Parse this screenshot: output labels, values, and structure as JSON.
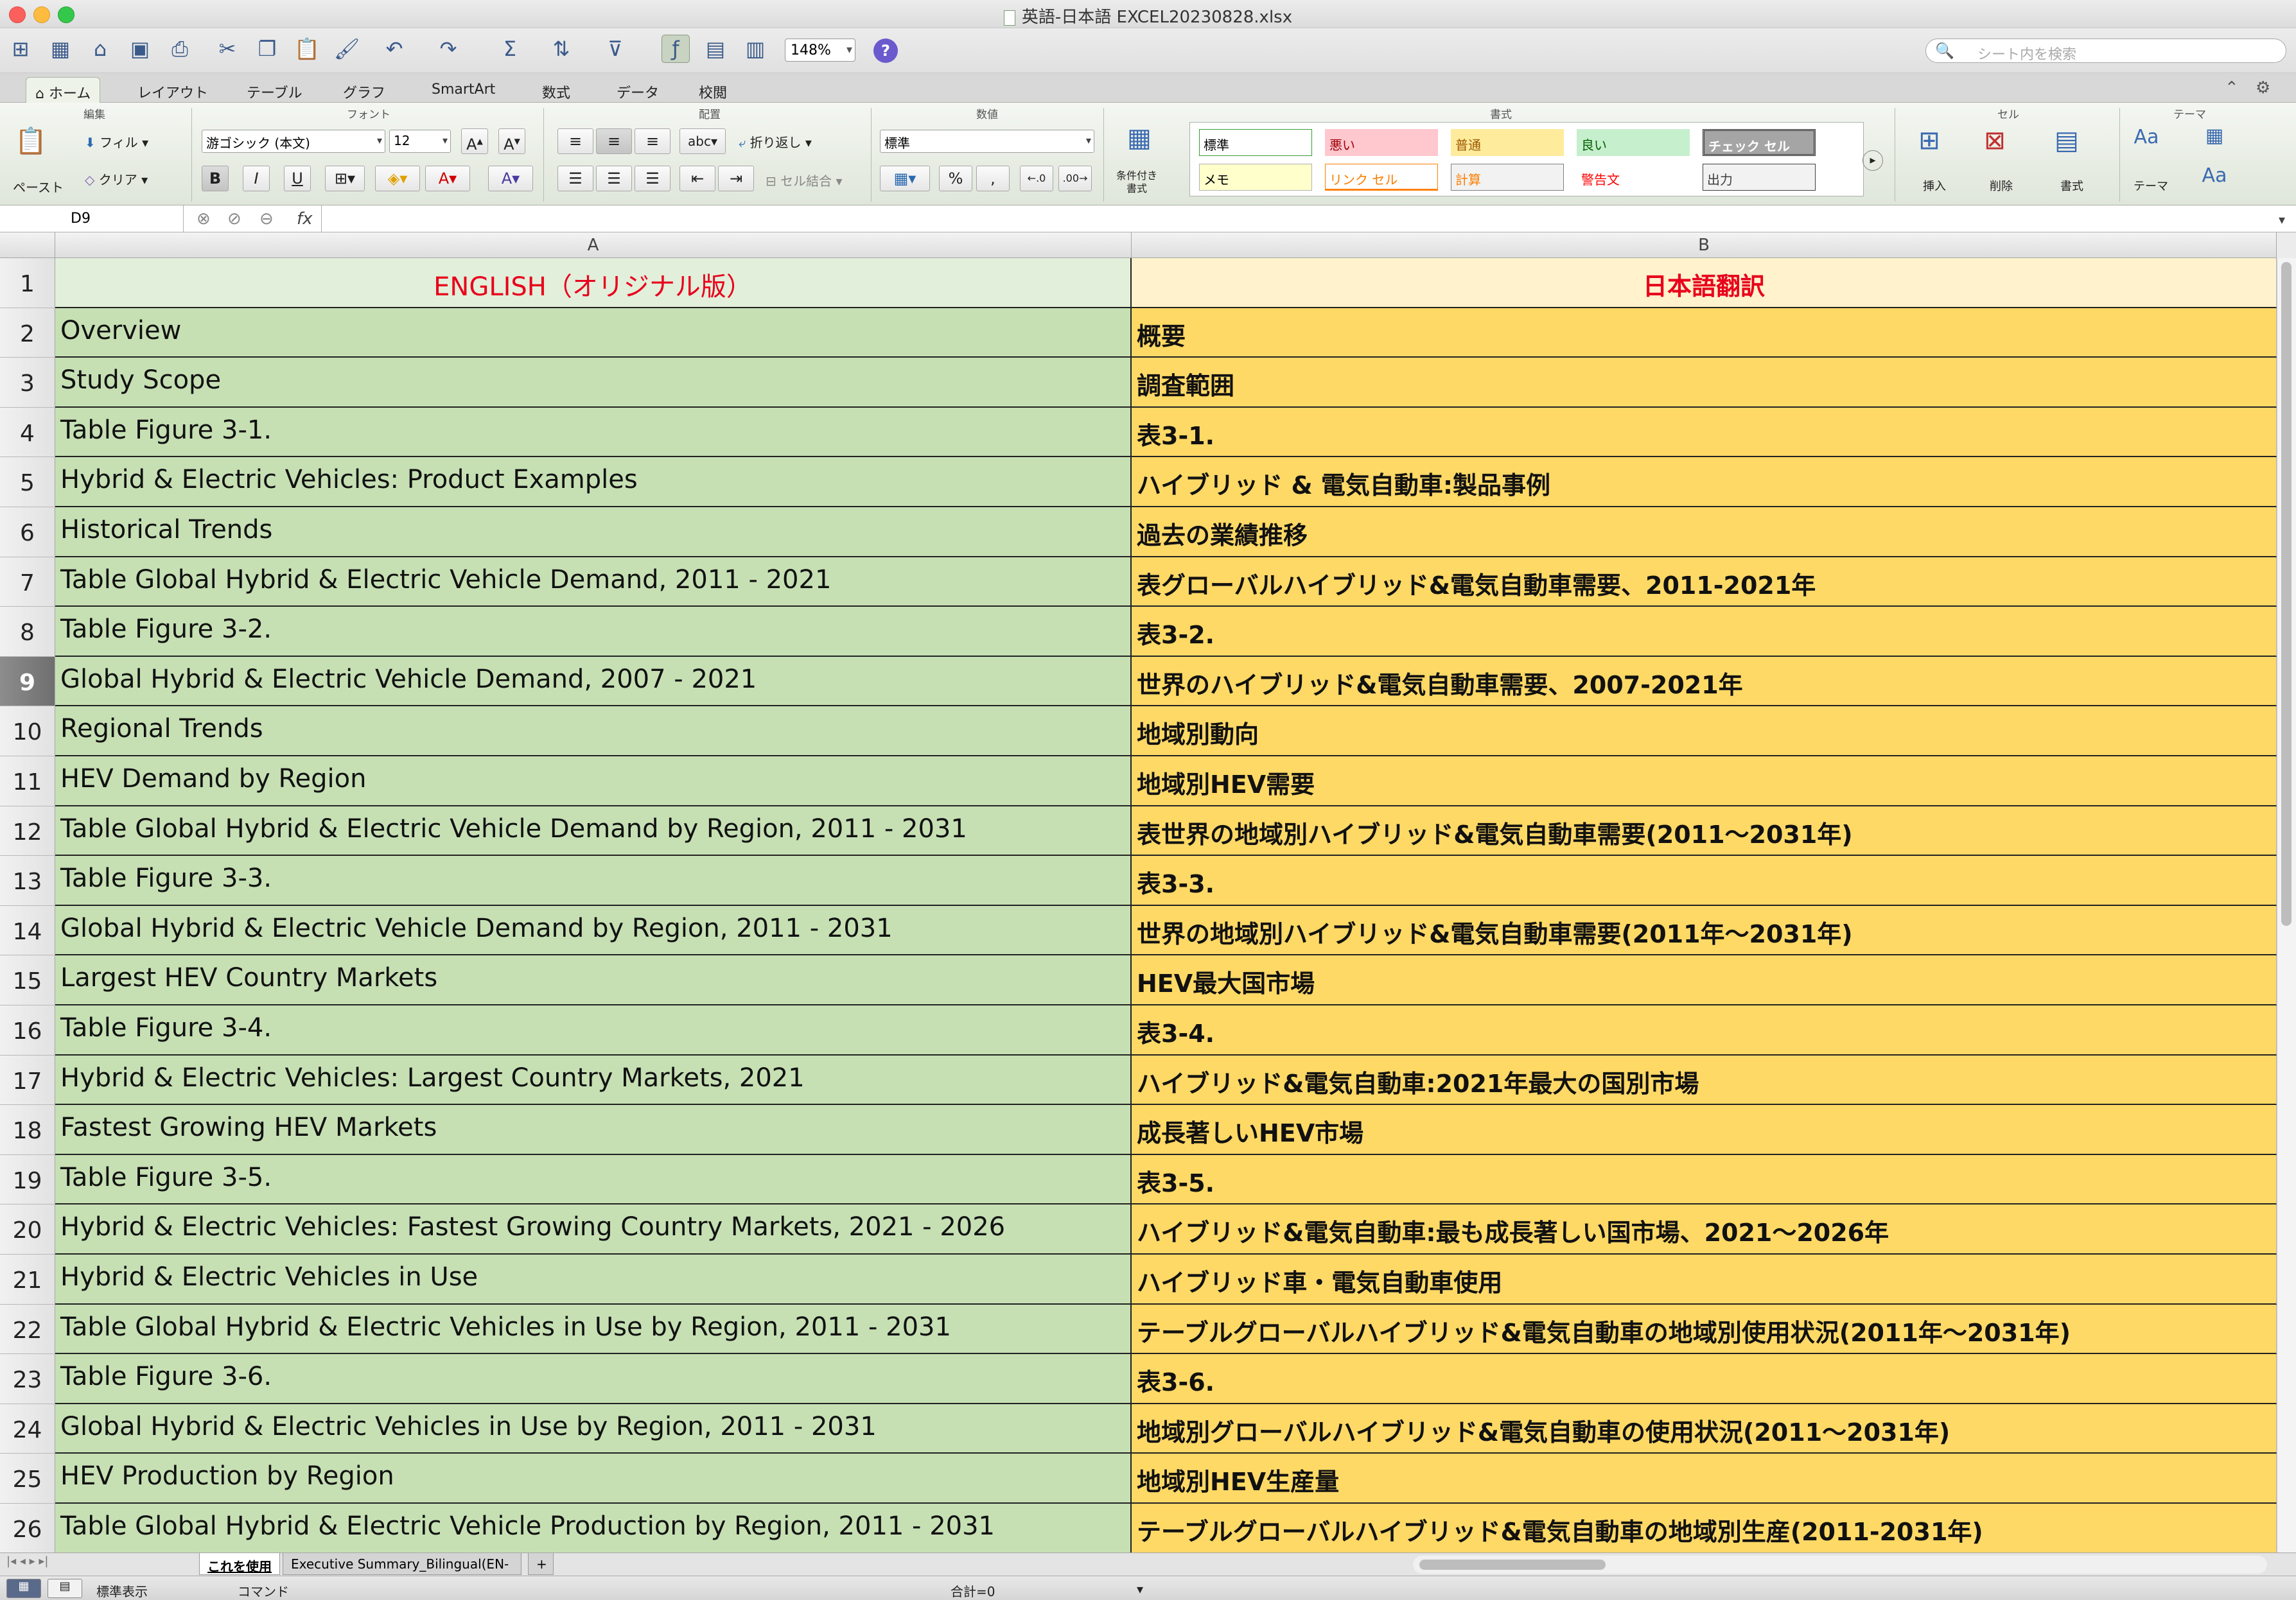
{
  "window": {
    "title": "英語-日本語 EXCEL20230828.xlsx"
  },
  "toolbar": {
    "zoom": "148%",
    "search_placeholder": "シート内を検索"
  },
  "tabs": [
    "ホーム",
    "レイアウト",
    "テーブル",
    "グラフ",
    "SmartArt",
    "数式",
    "データ",
    "校閲"
  ],
  "ribbon": {
    "groups": {
      "edit": "編集",
      "font": "フォント",
      "align": "配置",
      "number": "数値",
      "format": "書式",
      "cells": "セル",
      "theme": "テーマ"
    },
    "paste": "ペースト",
    "fill": "フィル",
    "clear": "クリア",
    "font_name": "游ゴシック (本文)",
    "font_size": "12",
    "bold": "B",
    "italic": "I",
    "underline": "U",
    "abc": "abc",
    "wrap": "折り返し",
    "merge": "セル結合",
    "number_format": "標準",
    "cond_format": "条件付き\n書式",
    "styles": [
      {
        "label": "標準",
        "bg": "#ffffff",
        "fg": "#000000",
        "border": "#3a9a3a"
      },
      {
        "label": "悪い",
        "bg": "#ffc7ce",
        "fg": "#9c0006",
        "border": "#ffc7ce"
      },
      {
        "label": "普通",
        "bg": "#ffeb9c",
        "fg": "#9c5700",
        "border": "#ffeb9c"
      },
      {
        "label": "良い",
        "bg": "#c6efce",
        "fg": "#006100",
        "border": "#c6efce"
      },
      {
        "label": "チェック セル",
        "bg": "#a5a5a5",
        "fg": "#ffffff",
        "border": "#3f3f3f"
      },
      {
        "label": "メモ",
        "bg": "#ffffcc",
        "fg": "#000000",
        "border": "#b2b2b2"
      },
      {
        "label": "リンク セル",
        "bg": "#ffffff",
        "fg": "#fa7d00",
        "border": "#ff8001"
      },
      {
        "label": "計算",
        "bg": "#f2f2f2",
        "fg": "#fa7d00",
        "border": "#7f7f7f"
      },
      {
        "label": "警告文",
        "bg": "#ffffff",
        "fg": "#ff0000",
        "border": "#ffffff"
      },
      {
        "label": "出力",
        "bg": "#f2f2f2",
        "fg": "#3f3f3f",
        "border": "#3f3f3f"
      }
    ],
    "insert": "挿入",
    "delete": "削除",
    "format": "書式",
    "theme": "テーマ"
  },
  "formula_bar": {
    "cell_ref": "D9",
    "fx": "fx",
    "content": ""
  },
  "columns": [
    "A",
    "B"
  ],
  "header_row": {
    "num": "1",
    "a": "ENGLISH（オリジナル版）",
    "b": "日本語翻訳"
  },
  "rows": [
    {
      "num": "2",
      "a": "Overview",
      "b": "概要"
    },
    {
      "num": "3",
      "a": "Study Scope",
      "b": "調査範囲"
    },
    {
      "num": "4",
      "a": "Table Figure 3-1.",
      "b": "表3-1."
    },
    {
      "num": "5",
      "a": "Hybrid & Electric Vehicles: Product Examples",
      "b": "ハイブリッド & 電気自動車:製品事例"
    },
    {
      "num": "6",
      "a": "Historical Trends",
      "b": "過去の業績推移"
    },
    {
      "num": "7",
      "a": "Table Global Hybrid & Electric Vehicle Demand, 2011 - 2021",
      "b": "表グローバルハイブリッド&電気自動車需要、2011-2021年"
    },
    {
      "num": "8",
      "a": "Table Figure 3-2.",
      "b": "表3-2."
    },
    {
      "num": "9",
      "a": "Global Hybrid & Electric Vehicle Demand, 2007 - 2021",
      "b": "世界のハイブリッド&電気自動車需要、2007-2021年"
    },
    {
      "num": "10",
      "a": "Regional Trends",
      "b": "地域別動向"
    },
    {
      "num": "11",
      "a": "HEV Demand by Region",
      "b": "地域別HEV需要"
    },
    {
      "num": "12",
      "a": "Table Global Hybrid & Electric Vehicle Demand by Region, 2011 - 2031",
      "b": "表世界の地域別ハイブリッド&電気自動車需要(2011～2031年)"
    },
    {
      "num": "13",
      "a": "Table Figure 3-3.",
      "b": "表3-3."
    },
    {
      "num": "14",
      "a": "Global Hybrid & Electric Vehicle Demand by Region, 2011 - 2031",
      "b": "世界の地域別ハイブリッド&電気自動車需要(2011年～2031年)"
    },
    {
      "num": "15",
      "a": "Largest HEV Country Markets",
      "b": "HEV最大国市場"
    },
    {
      "num": "16",
      "a": "Table Figure 3-4.",
      "b": "表3-4."
    },
    {
      "num": "17",
      "a": "Hybrid & Electric Vehicles: Largest Country Markets, 2021",
      "b": "ハイブリッド&電気自動車:2021年最大の国別市場"
    },
    {
      "num": "18",
      "a": "Fastest Growing HEV Markets",
      "b": "成長著しいHEV市場"
    },
    {
      "num": "19",
      "a": "Table Figure 3-5.",
      "b": "表3-5."
    },
    {
      "num": "20",
      "a": "Hybrid & Electric Vehicles: Fastest Growing Country Markets, 2021 - 2026",
      "b": "ハイブリッド&電気自動車:最も成長著しい国市場、2021～2026年"
    },
    {
      "num": "21",
      "a": "Hybrid & Electric Vehicles in Use",
      "b": "ハイブリッド車・電気自動車使用"
    },
    {
      "num": "22",
      "a": "Table Global Hybrid & Electric Vehicles in Use by Region, 2011 - 2031",
      "b": "テーブルグローバルハイブリッド&電気自動車の地域別使用状況(2011年～2031年)"
    },
    {
      "num": "23",
      "a": "Table Figure 3-6.",
      "b": "表3-6."
    },
    {
      "num": "24",
      "a": "Global Hybrid & Electric Vehicles in Use by Region, 2011 - 2031",
      "b": "地域別グローバルハイブリッド&電気自動車の使用状況(2011～2031年)"
    },
    {
      "num": "25",
      "a": "HEV Production by Region",
      "b": "地域別HEV生産量"
    },
    {
      "num": "26",
      "a": "Table Global Hybrid & Electric Vehicle Production by Region, 2011 - 2031",
      "b": "テーブルグローバルハイブリッド&電気自動車の地域別生産(2011-2031年)"
    }
  ],
  "selected_row": "9",
  "sheets": [
    "これを使用",
    "Executive Summary_Bilingual(EN-"
  ],
  "status": {
    "view": "標準表示",
    "mode": "コマンド",
    "sum": "合計=0"
  }
}
